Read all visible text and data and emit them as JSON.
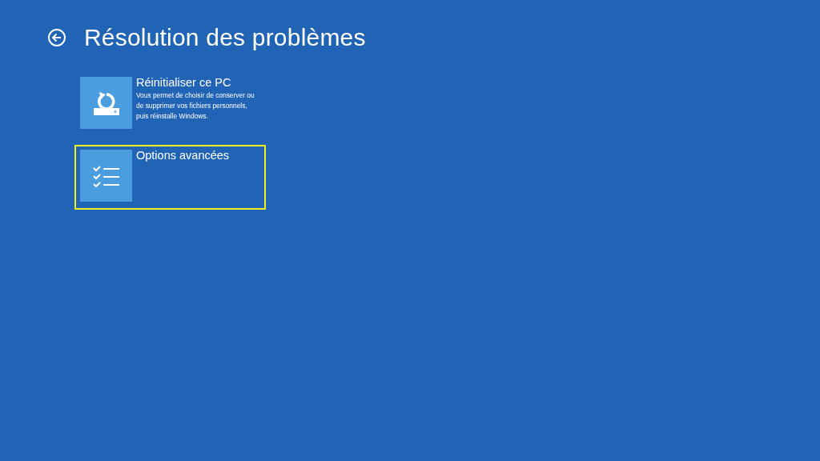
{
  "page": {
    "title": "Résolution des problèmes"
  },
  "options": [
    {
      "kind": "reset",
      "title": "Réinitialiser ce PC",
      "description": "Vous permet de choisir de conserver ou de supprimer vos fichiers personnels, puis réinstalle Windows.",
      "selected": false
    },
    {
      "kind": "advanced",
      "title": "Options avancées",
      "selected": true
    }
  ]
}
